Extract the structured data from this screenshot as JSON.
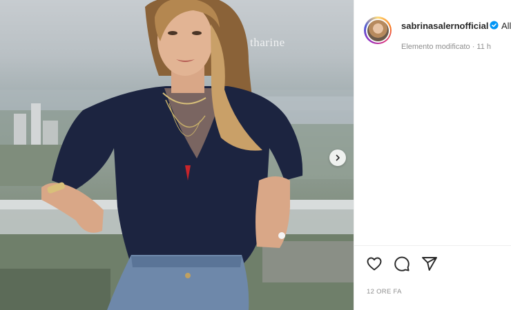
{
  "post": {
    "image_watermark": "tharine",
    "username": "sabrinasalernofficial",
    "follow_fragment": "All",
    "edited_label": "Elemento modificato · 11 h",
    "timestamp": "12 ORE FA"
  },
  "icons": {
    "next": "chevron-right-icon",
    "like": "heart-icon",
    "comment": "comment-icon",
    "share": "share-icon",
    "verified": "verified-badge-icon"
  },
  "colors": {
    "verified": "#0095f6",
    "text_primary": "#262626",
    "text_secondary": "#8e8e8e",
    "top": "#1c2440"
  }
}
